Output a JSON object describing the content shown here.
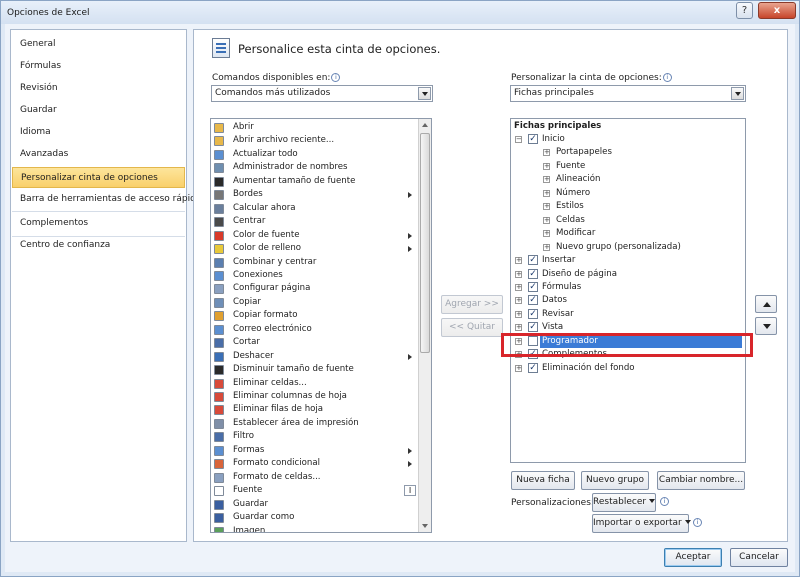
{
  "window": {
    "title": "Opciones de Excel",
    "help_glyph": "?",
    "close_glyph": "x"
  },
  "nav": {
    "items": [
      {
        "label": "General"
      },
      {
        "label": "Fórmulas"
      },
      {
        "label": "Revisión"
      },
      {
        "label": "Guardar"
      },
      {
        "label": "Idioma"
      },
      {
        "label": "Avanzadas"
      },
      {
        "label": "Personalizar cinta de opciones",
        "selected": true
      },
      {
        "label": "Barra de herramientas de acceso rápido"
      },
      {
        "label": "Complementos"
      },
      {
        "label": "Centro de confianza"
      }
    ]
  },
  "header": {
    "title": "Personalice esta cinta de opciones."
  },
  "left_panel": {
    "label": "Comandos disponibles en:",
    "combo_value": "Comandos más utilizados",
    "commands": [
      {
        "label": "Abrir",
        "icon": "folder-open-icon",
        "color": "#e8b84a"
      },
      {
        "label": "Abrir archivo reciente...",
        "icon": "recent-file-icon",
        "color": "#e8b84a"
      },
      {
        "label": "Actualizar todo",
        "icon": "refresh-all-icon",
        "color": "#5b8fd1"
      },
      {
        "label": "Administrador de nombres",
        "icon": "name-manager-icon",
        "color": "#6f8fb0"
      },
      {
        "label": "Aumentar tamaño de fuente",
        "icon": "font-grow-icon",
        "color": "#2a2a2a"
      },
      {
        "label": "Bordes",
        "icon": "borders-icon",
        "color": "#777777",
        "submenu": true
      },
      {
        "label": "Calcular ahora",
        "icon": "calculator-icon",
        "color": "#6a7f9c"
      },
      {
        "label": "Centrar",
        "icon": "align-center-icon",
        "color": "#4a4a4a"
      },
      {
        "label": "Color de fuente",
        "icon": "font-color-icon",
        "color": "#d83a2a",
        "submenu": true
      },
      {
        "label": "Color de relleno",
        "icon": "fill-color-icon",
        "color": "#e8c93a",
        "submenu": true
      },
      {
        "label": "Combinar y centrar",
        "icon": "merge-center-icon",
        "color": "#5b7fb0"
      },
      {
        "label": "Conexiones",
        "icon": "connections-icon",
        "color": "#5b8fd1"
      },
      {
        "label": "Configurar página",
        "icon": "page-setup-icon",
        "color": "#8aa0c0"
      },
      {
        "label": "Copiar",
        "icon": "copy-icon",
        "color": "#6f8fb8"
      },
      {
        "label": "Copiar formato",
        "icon": "format-painter-icon",
        "color": "#e0a030"
      },
      {
        "label": "Correo electrónico",
        "icon": "email-icon",
        "color": "#5b8fd1"
      },
      {
        "label": "Cortar",
        "icon": "scissors-icon",
        "color": "#4a6ea8"
      },
      {
        "label": "Deshacer",
        "icon": "undo-icon",
        "color": "#3a6fb6",
        "submenu": true
      },
      {
        "label": "Disminuir tamaño de fuente",
        "icon": "font-shrink-icon",
        "color": "#2a2a2a"
      },
      {
        "label": "Eliminar celdas...",
        "icon": "delete-cells-icon",
        "color": "#d84a3a"
      },
      {
        "label": "Eliminar columnas de hoja",
        "icon": "delete-columns-icon",
        "color": "#d84a3a"
      },
      {
        "label": "Eliminar filas de hoja",
        "icon": "delete-rows-icon",
        "color": "#d84a3a"
      },
      {
        "label": "Establecer área de impresión",
        "icon": "print-area-icon",
        "color": "#7f8fa8"
      },
      {
        "label": "Filtro",
        "icon": "filter-icon",
        "color": "#4a6ea8"
      },
      {
        "label": "Formas",
        "icon": "shapes-icon",
        "color": "#5b8fd1",
        "submenu": true
      },
      {
        "label": "Formato condicional",
        "icon": "conditional-format-icon",
        "color": "#d8643a",
        "submenu": true
      },
      {
        "label": "Formato de celdas...",
        "icon": "format-cells-icon",
        "color": "#8aa0c0"
      },
      {
        "label": "Fuente",
        "icon": "font-icon",
        "color": "#ffffff",
        "font_combo": "I"
      },
      {
        "label": "Guardar",
        "icon": "save-icon",
        "color": "#3a5fa0"
      },
      {
        "label": "Guardar como",
        "icon": "save-as-icon",
        "color": "#3a5fa0"
      },
      {
        "label": "Imagen",
        "icon": "picture-icon",
        "color": "#5ba05b"
      }
    ]
  },
  "middle": {
    "add_label": "Agregar >>",
    "remove_label": "<< Quitar"
  },
  "right_panel": {
    "label": "Personalizar la cinta de opciones:",
    "combo_value": "Fichas principales",
    "tree_header": "Fichas principales",
    "tree": [
      {
        "label": "Inicio",
        "level": 0,
        "expanded": true,
        "checked": true,
        "expand_glyph": "−",
        "check_glyph": "✓"
      },
      {
        "label": "Portapapeles",
        "level": 1,
        "expand_glyph": "+"
      },
      {
        "label": "Fuente",
        "level": 1,
        "expand_glyph": "+"
      },
      {
        "label": "Alineación",
        "level": 1,
        "expand_glyph": "+"
      },
      {
        "label": "Número",
        "level": 1,
        "expand_glyph": "+"
      },
      {
        "label": "Estilos",
        "level": 1,
        "expand_glyph": "+"
      },
      {
        "label": "Celdas",
        "level": 1,
        "expand_glyph": "+"
      },
      {
        "label": "Modificar",
        "level": 1,
        "expand_glyph": "+"
      },
      {
        "label": "Nuevo grupo (personalizada)",
        "level": 1,
        "expand_glyph": "+"
      },
      {
        "label": "Insertar",
        "level": 0,
        "checked": true,
        "expand_glyph": "+",
        "check_glyph": "✓"
      },
      {
        "label": "Diseño de página",
        "level": 0,
        "checked": true,
        "expand_glyph": "+",
        "check_glyph": "✓"
      },
      {
        "label": "Fórmulas",
        "level": 0,
        "checked": true,
        "expand_glyph": "+",
        "check_glyph": "✓"
      },
      {
        "label": "Datos",
        "level": 0,
        "checked": true,
        "expand_glyph": "+",
        "check_glyph": "✓"
      },
      {
        "label": "Revisar",
        "level": 0,
        "checked": true,
        "expand_glyph": "+",
        "check_glyph": "✓"
      },
      {
        "label": "Vista",
        "level": 0,
        "checked": true,
        "expand_glyph": "+",
        "check_glyph": "✓"
      },
      {
        "label": "Programador",
        "level": 0,
        "checked": false,
        "selected": true,
        "expand_glyph": "+",
        "check_glyph": ""
      },
      {
        "label": "Complementos",
        "level": 0,
        "checked": true,
        "expand_glyph": "+",
        "check_glyph": "✓"
      },
      {
        "label": "Eliminación del fondo",
        "level": 0,
        "checked": true,
        "expand_glyph": "+",
        "check_glyph": "✓"
      }
    ],
    "new_tab_label": "Nueva ficha",
    "new_group_label": "Nuevo grupo",
    "rename_label": "Cambiar nombre...",
    "customizations_label": "Personalizaciones:",
    "reset_label": "Restablecer",
    "import_export_label": "Importar o exportar",
    "info_glyph": "i"
  },
  "footer": {
    "ok_label": "Aceptar",
    "cancel_label": "Cancelar"
  },
  "colors": {
    "selected_nav": "#f9d06b",
    "selected_row": "#3b7bd6",
    "annotation_box": "#d8252a"
  }
}
